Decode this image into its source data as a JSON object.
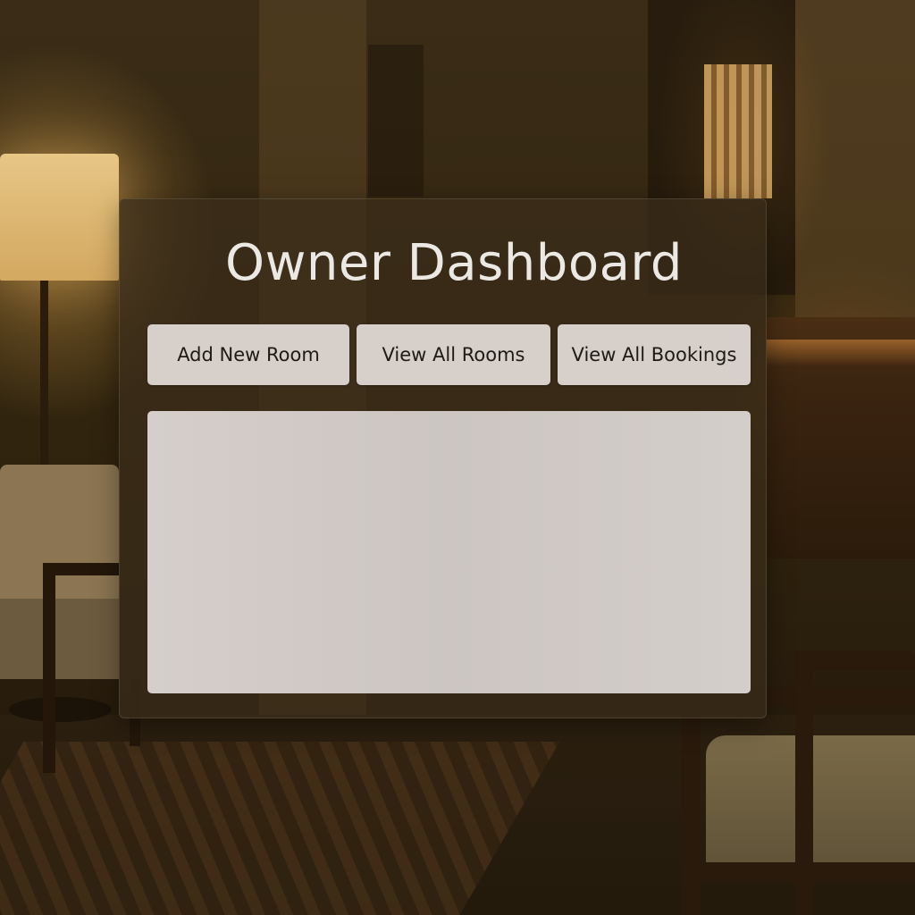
{
  "dashboard": {
    "title": "Owner Dashboard",
    "buttons": {
      "add_room": "Add New Room",
      "view_rooms": "View All Rooms",
      "view_bookings": "View All Bookings"
    }
  },
  "colors": {
    "panel_bg": "#3a2c1a",
    "button_bg": "#d7cfca",
    "content_bg": "#d0c9c5",
    "title_text": "#ece8e4"
  }
}
